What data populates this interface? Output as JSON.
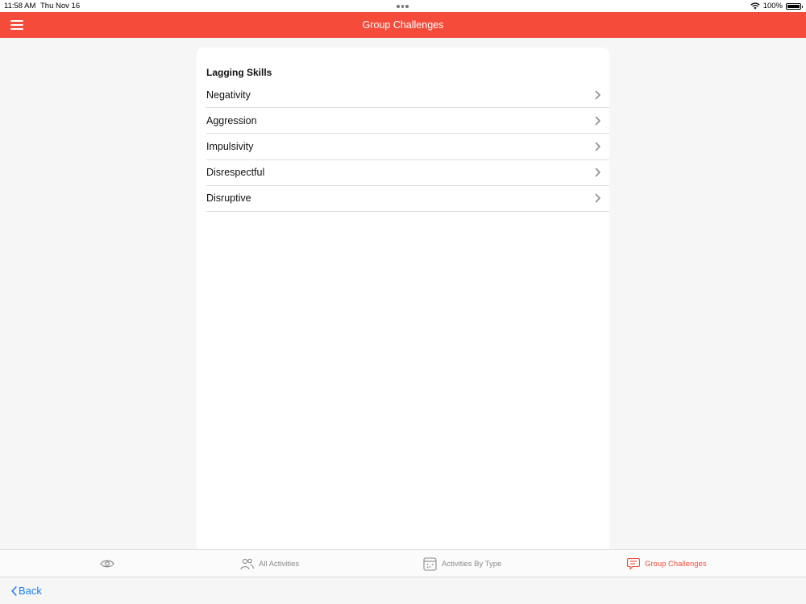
{
  "status_bar": {
    "time": "11:58 AM",
    "date": "Thu Nov 16",
    "battery": "100%"
  },
  "header": {
    "title": "Group Challenges",
    "menu_icon": "hamburger-menu-icon"
  },
  "section": {
    "title": "Lagging Skills",
    "items": [
      {
        "label": "Negativity"
      },
      {
        "label": "Aggression"
      },
      {
        "label": "Impulsivity"
      },
      {
        "label": "Disrespectful"
      },
      {
        "label": "Disruptive"
      }
    ]
  },
  "tabs": [
    {
      "label": "",
      "icon": "eye-icon"
    },
    {
      "label": "All Activities",
      "icon": "people-icon"
    },
    {
      "label": "Activities By Type",
      "icon": "calendar-grid-icon"
    },
    {
      "label": "Group Challenges",
      "icon": "chat-bubble-icon",
      "active": true
    }
  ],
  "footer": {
    "back_label": "Back"
  },
  "colors": {
    "accent": "#f44b3a",
    "link": "#1b7ff5"
  }
}
